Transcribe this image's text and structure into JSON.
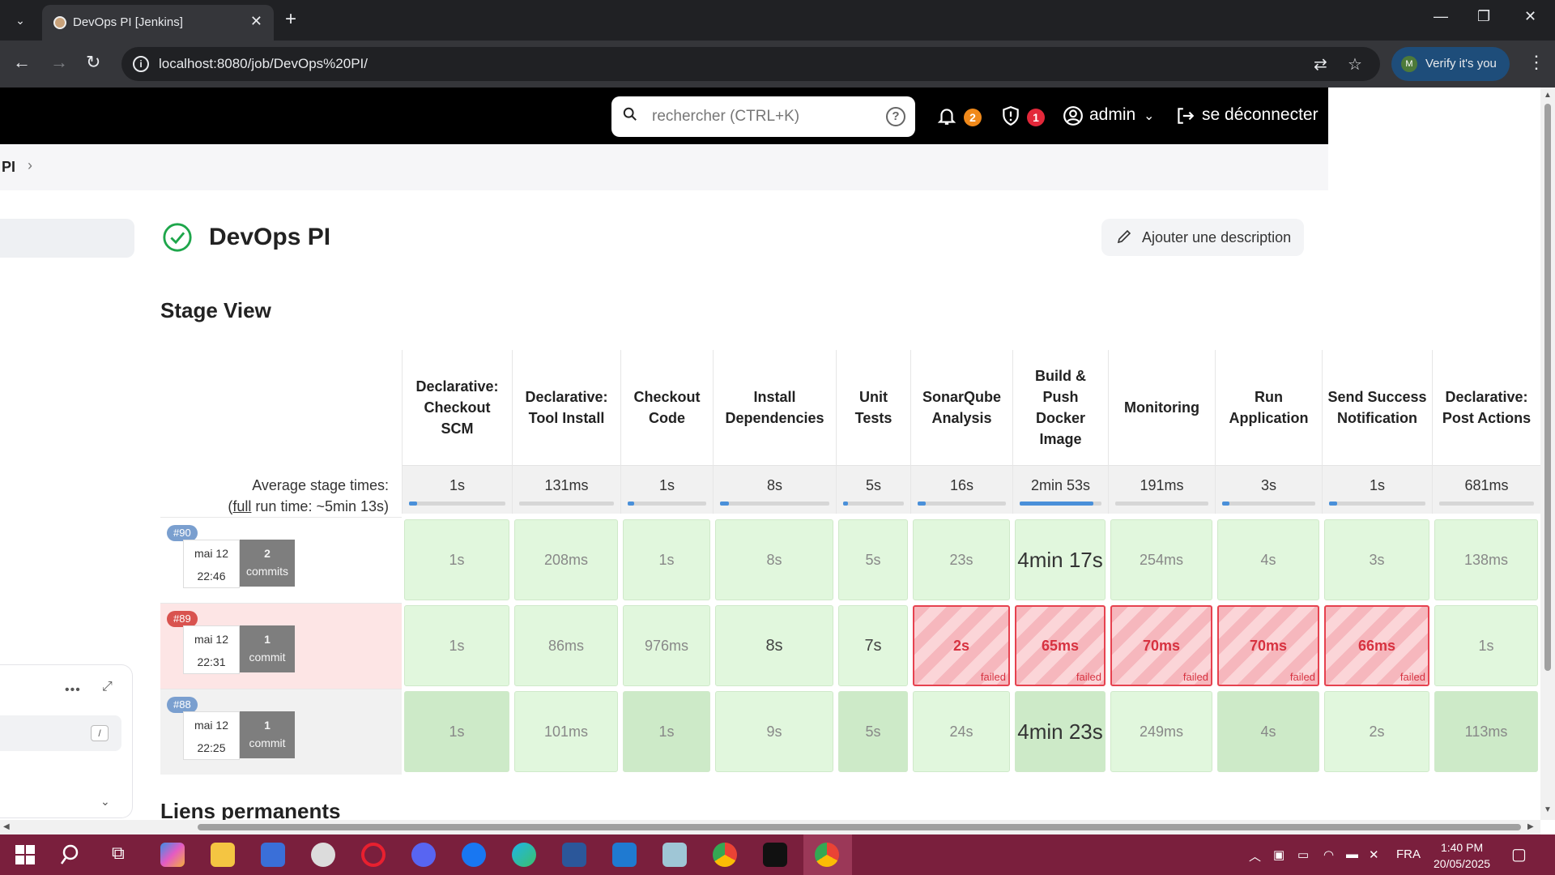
{
  "browser": {
    "tab_title": "DevOps PI [Jenkins]",
    "url": "localhost:8080/job/DevOps%20PI/",
    "verify_label": "Verify it's you",
    "verify_avatar": "M"
  },
  "header": {
    "search_placeholder": "rechercher (CTRL+K)",
    "notifications_count": "2",
    "security_count": "1",
    "user": "admin",
    "logout": "se déconnecter"
  },
  "breadcrumb": {
    "text": "PI"
  },
  "job": {
    "title": "DevOps PI",
    "add_description": "Ajouter une description",
    "status_color": "#1ea64b"
  },
  "stage_view": {
    "title": "Stage View",
    "avg_label_line1": "Average stage times:",
    "avg_label_prefix": "(",
    "avg_label_link": "full",
    "avg_label_suffix": " run time: ~5min 13s)",
    "stages": [
      {
        "name": "Declarative: Checkout SCM",
        "avg": "1s",
        "fill": 0.01
      },
      {
        "name": "Declarative: Tool Install",
        "avg": "131ms",
        "fill": 0.0
      },
      {
        "name": "Checkout Code",
        "avg": "1s",
        "fill": 0.01
      },
      {
        "name": "Install Dependencies",
        "avg": "8s",
        "fill": 0.05
      },
      {
        "name": "Unit Tests",
        "avg": "5s",
        "fill": 0.03
      },
      {
        "name": "SonarQube Analysis",
        "avg": "16s",
        "fill": 0.09
      },
      {
        "name": "Build & Push Docker Image",
        "avg": "2min 53s",
        "fill": 0.9
      },
      {
        "name": "Monitoring",
        "avg": "191ms",
        "fill": 0.0
      },
      {
        "name": "Run Application",
        "avg": "3s",
        "fill": 0.02
      },
      {
        "name": "Send Success Notification",
        "avg": "1s",
        "fill": 0.01
      },
      {
        "name": "Declarative: Post Actions",
        "avg": "681ms",
        "fill": 0.0
      }
    ],
    "builds": [
      {
        "tag": "#90",
        "tag_color": "#7a9fcf",
        "date": "mai 12",
        "time": "22:46",
        "commits_n": "2",
        "commits_label": "commits",
        "row_bg": "#ffffff",
        "cells": [
          {
            "v": "1s",
            "s": "ok"
          },
          {
            "v": "208ms",
            "s": "ok"
          },
          {
            "v": "1s",
            "s": "ok"
          },
          {
            "v": "8s",
            "s": "ok"
          },
          {
            "v": "5s",
            "s": "ok"
          },
          {
            "v": "23s",
            "s": "ok"
          },
          {
            "v": "4min 17s",
            "s": "ok",
            "big": true
          },
          {
            "v": "254ms",
            "s": "ok"
          },
          {
            "v": "4s",
            "s": "ok"
          },
          {
            "v": "3s",
            "s": "ok"
          },
          {
            "v": "138ms",
            "s": "ok"
          }
        ]
      },
      {
        "tag": "#89",
        "tag_color": "#d9534f",
        "date": "mai 12",
        "time": "22:31",
        "commits_n": "1",
        "commits_label": "commit",
        "row_bg": "#fde5e5",
        "cells": [
          {
            "v": "1s",
            "s": "ok"
          },
          {
            "v": "86ms",
            "s": "ok"
          },
          {
            "v": "976ms",
            "s": "ok"
          },
          {
            "v": "8s",
            "s": "ok",
            "med": true
          },
          {
            "v": "7s",
            "s": "ok",
            "med": true
          },
          {
            "v": "2s",
            "s": "failed"
          },
          {
            "v": "65ms",
            "s": "failed"
          },
          {
            "v": "70ms",
            "s": "failed"
          },
          {
            "v": "70ms",
            "s": "failed"
          },
          {
            "v": "66ms",
            "s": "failed"
          },
          {
            "v": "1s",
            "s": "ok"
          }
        ]
      },
      {
        "tag": "#88",
        "tag_color": "#7a9fcf",
        "date": "mai 12",
        "time": "22:25",
        "commits_n": "1",
        "commits_label": "commit",
        "row_bg": "#f1f1f1",
        "cells": [
          {
            "v": "1s",
            "s": "ok"
          },
          {
            "v": "101ms",
            "s": "ok"
          },
          {
            "v": "1s",
            "s": "ok"
          },
          {
            "v": "9s",
            "s": "ok"
          },
          {
            "v": "5s",
            "s": "ok"
          },
          {
            "v": "24s",
            "s": "ok"
          },
          {
            "v": "4min 23s",
            "s": "ok",
            "big": true
          },
          {
            "v": "249ms",
            "s": "ok"
          },
          {
            "v": "4s",
            "s": "ok"
          },
          {
            "v": "2s",
            "s": "ok"
          },
          {
            "v": "113ms",
            "s": "ok"
          }
        ]
      }
    ],
    "failed_label": "failed"
  },
  "permalinks_title": "Liens permanents",
  "sidebar": {
    "shortcut_key": "/"
  },
  "taskbar": {
    "lang": "FRA",
    "time": "1:40 PM",
    "date": "20/05/2025"
  }
}
